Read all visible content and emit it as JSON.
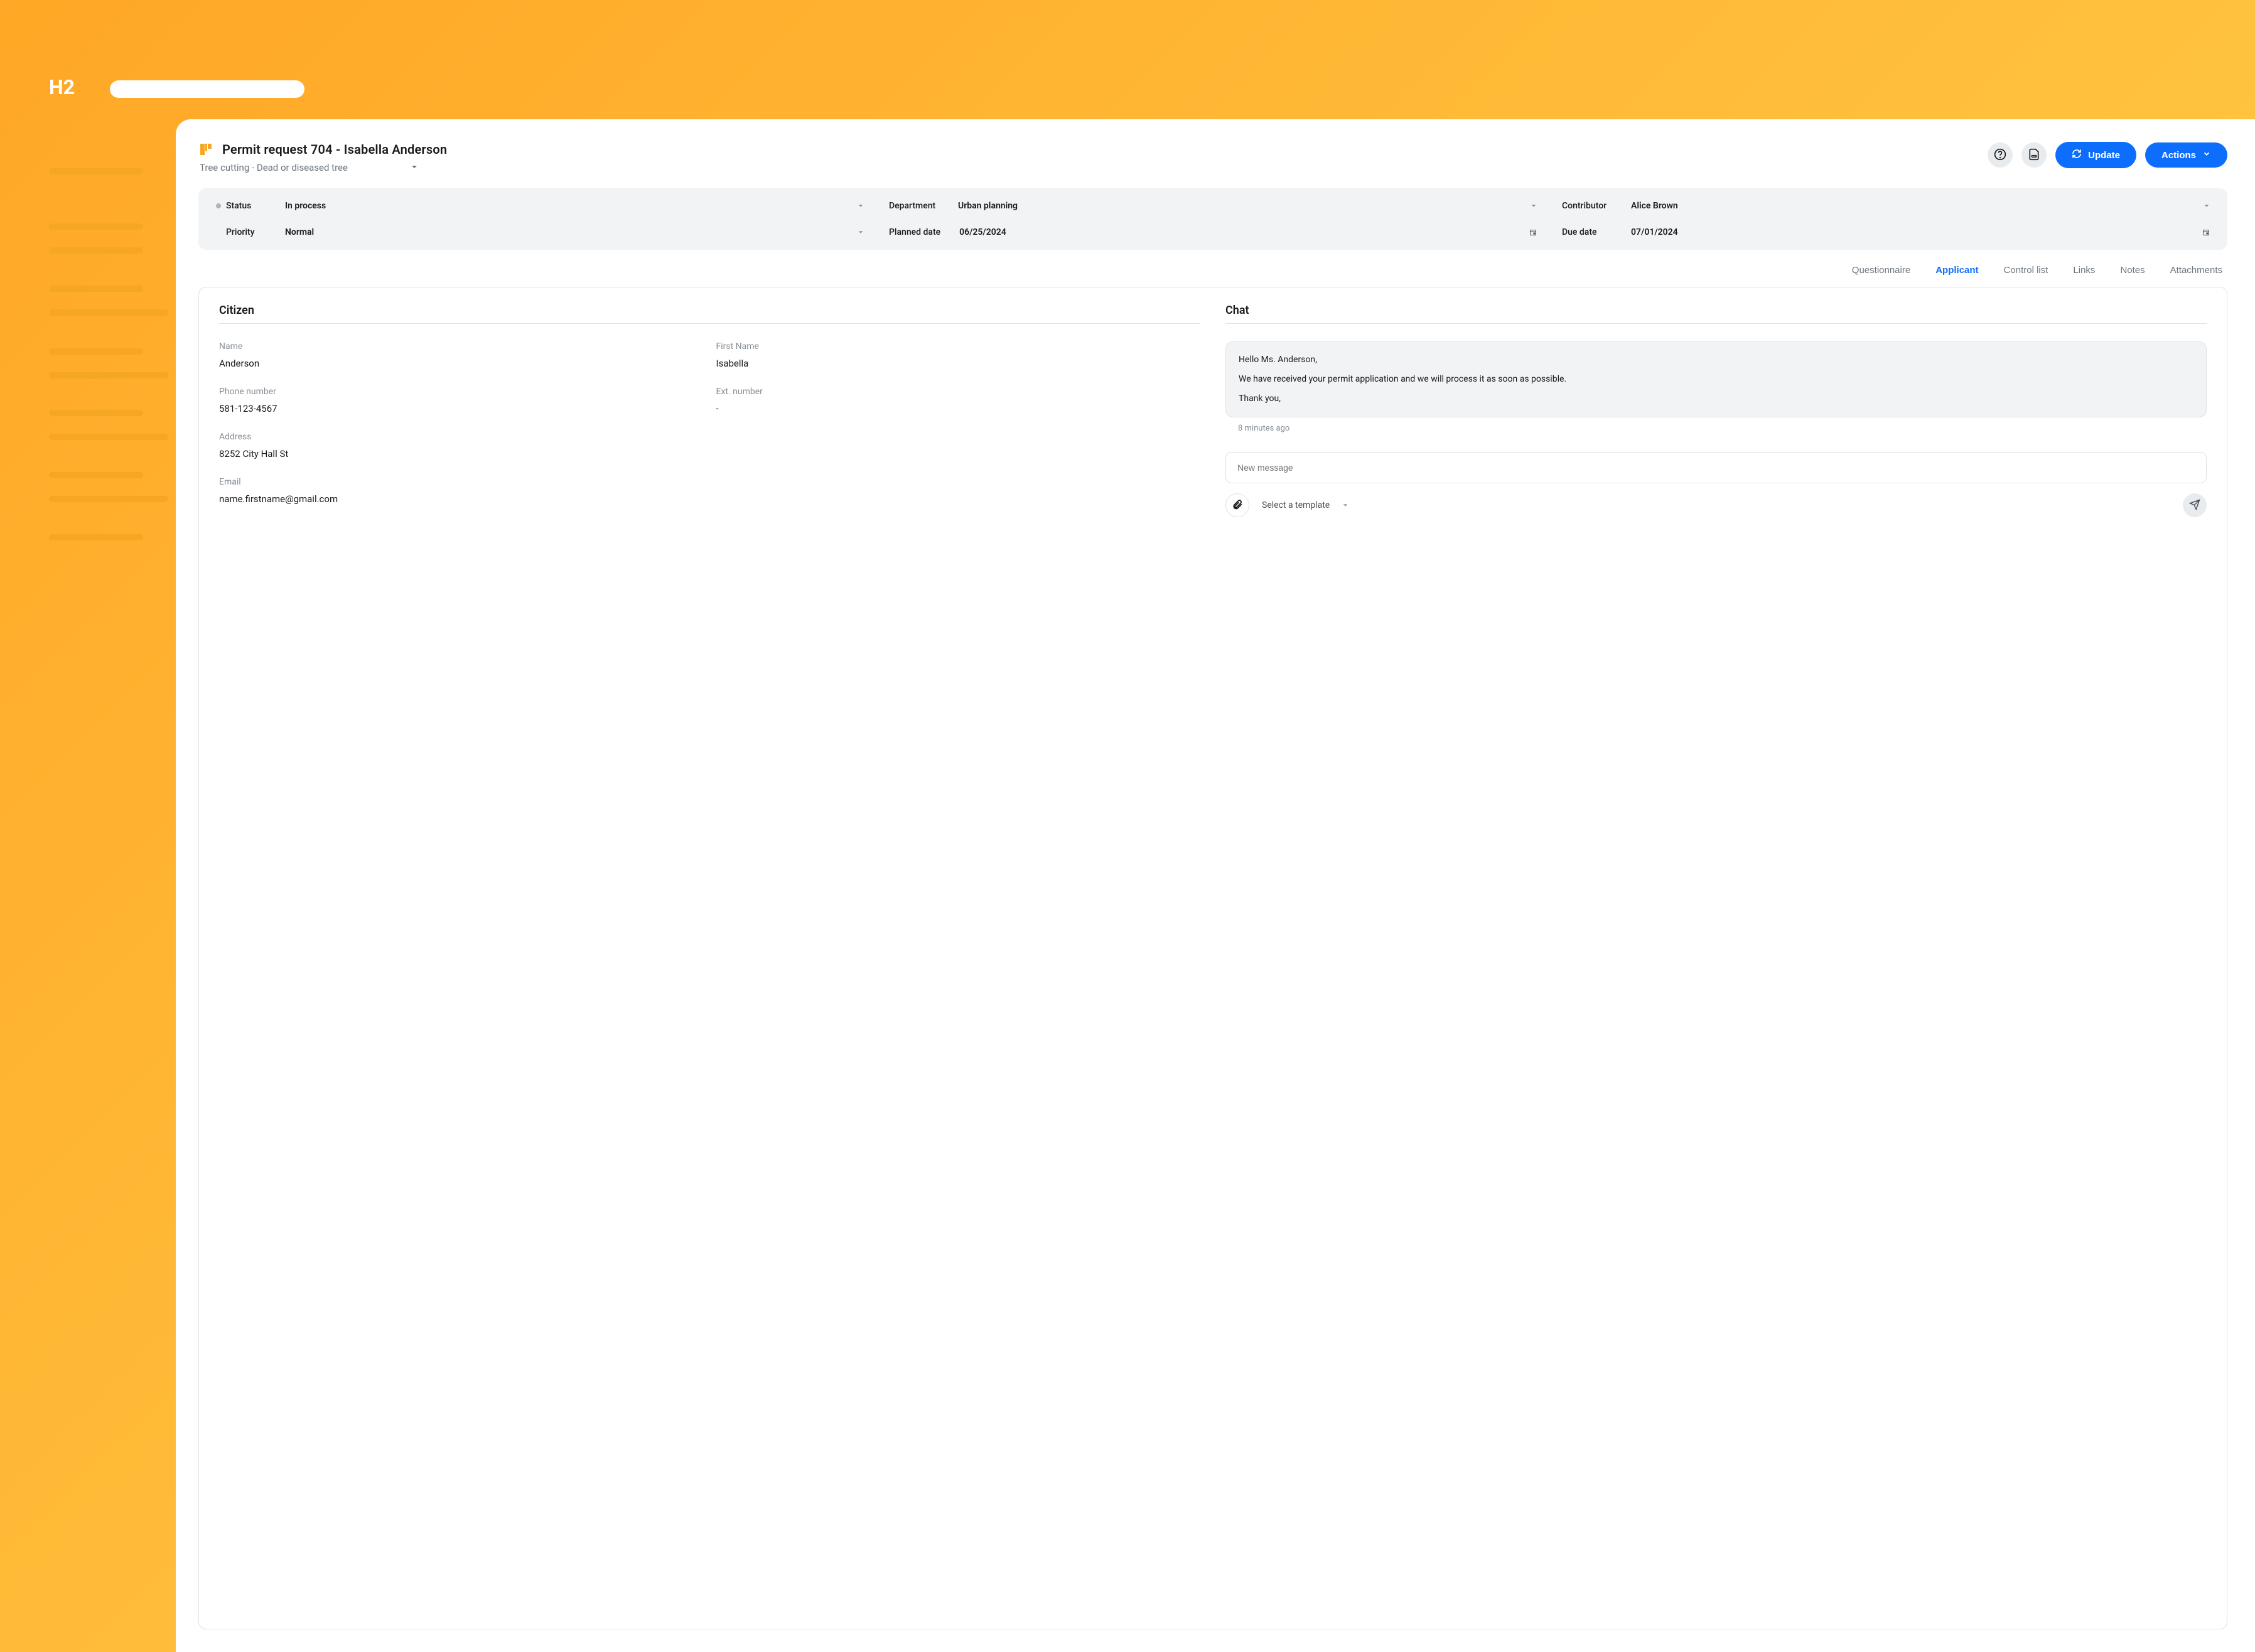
{
  "bg_label": "H2",
  "header": {
    "title": "Permit request 704 - Isabella Anderson",
    "subtitle": "Tree cutting - Dead or diseased tree",
    "update_label": "Update",
    "actions_label": "Actions"
  },
  "meta": {
    "status": {
      "label": "Status",
      "value": "In process"
    },
    "department": {
      "label": "Department",
      "value": "Urban planning"
    },
    "contributor": {
      "label": "Contributor",
      "value": "Alice Brown"
    },
    "priority": {
      "label": "Priority",
      "value": "Normal"
    },
    "planned_date": {
      "label": "Planned date",
      "value": "06/25/2024"
    },
    "due_date": {
      "label": "Due date",
      "value": "07/01/2024"
    }
  },
  "tabs": {
    "questionnaire": "Questionnaire",
    "applicant": "Applicant",
    "control_list": "Control list",
    "links": "Links",
    "notes": "Notes",
    "attachments": "Attachments"
  },
  "citizen": {
    "section_title": "Citizen",
    "name": {
      "label": "Name",
      "value": "Anderson"
    },
    "first_name": {
      "label": "First Name",
      "value": "Isabella"
    },
    "phone": {
      "label": "Phone number",
      "value": "581-123-4567"
    },
    "ext": {
      "label": "Ext. number",
      "value": "-"
    },
    "address": {
      "label": "Address",
      "value": "8252 City Hall St"
    },
    "email": {
      "label": "Email",
      "value": "name.firstname@gmail.com"
    }
  },
  "chat": {
    "section_title": "Chat",
    "message": {
      "line1": "Hello Ms. Anderson,",
      "line2": "We have received your permit application and we will process it as soon as possible.",
      "line3": "Thank you,"
    },
    "timestamp": "8 minutes ago",
    "input_placeholder": "New message",
    "template_label": "Select a template"
  }
}
